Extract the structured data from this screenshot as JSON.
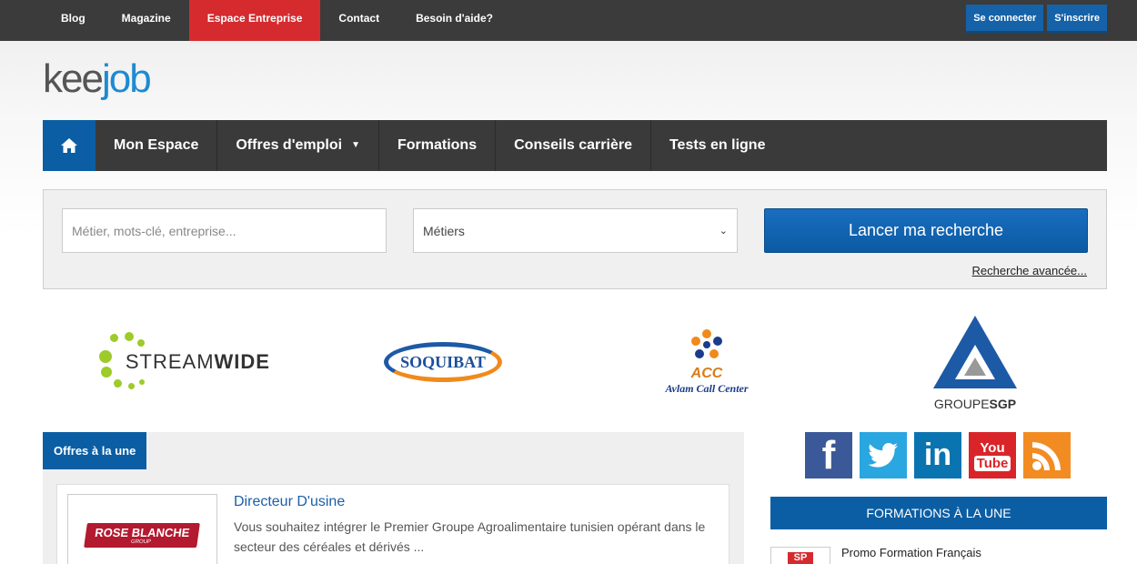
{
  "topnav": {
    "items": [
      "Blog",
      "Magazine",
      "Espace Entreprise",
      "Contact",
      "Besoin d'aide?"
    ],
    "active_index": 2,
    "login_label": "Se connecter",
    "signup_label": "S'inscrire"
  },
  "logo": {
    "part1": "kee",
    "part2": "job"
  },
  "mainnav": {
    "home_icon": "home-icon",
    "items": [
      "Mon Espace",
      "Offres d'emploi",
      "Formations",
      "Conseils carrière",
      "Tests en ligne"
    ]
  },
  "search": {
    "placeholder": "Métier, mots-clé, entreprise...",
    "select_value": "Métiers",
    "button_label": "Lancer ma recherche",
    "advanced_label": "Recherche avancée..."
  },
  "partners": {
    "streamwide": {
      "light": "STREAM",
      "bold": "WIDE"
    },
    "soquibat": "SOQUIBAT",
    "acc": {
      "name": "ACC",
      "sub": "Avlam Call Center"
    },
    "sgp": {
      "light": "GROUPE",
      "bold": "SGP"
    }
  },
  "offers": {
    "tab_label": "Offres à la une",
    "items": [
      {
        "company_logo": {
          "name": "ROSE BLANCHE",
          "sub": "GROUP"
        },
        "title": "Directeur D'usine",
        "description": "Vous souhaitez intégrer le Premier Groupe Agroalimentaire tunisien opérant dans le secteur des céréales et dérivés ..."
      }
    ]
  },
  "social": [
    "facebook-icon",
    "twitter-icon",
    "linkedin-icon",
    "youtube-icon",
    "rss-icon"
  ],
  "formations": {
    "heading": "FORMATIONS À LA UNE",
    "items": [
      {
        "thumb_text": "SP",
        "title": "Promo Formation Français"
      }
    ]
  },
  "colors": {
    "topbar": "#3b3b3b",
    "active_red": "#d52b2f",
    "brand_blue": "#0b5ea3",
    "nav_dark": "#3a3a3a"
  }
}
